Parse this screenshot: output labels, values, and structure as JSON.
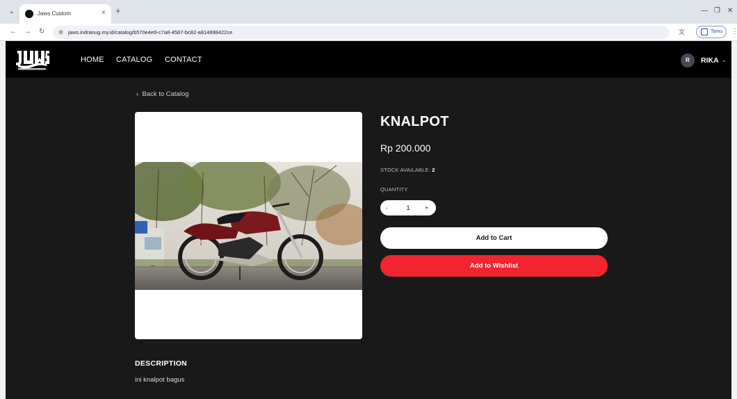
{
  "browser": {
    "tab_title": "Jaws Custom",
    "tab_close": "×",
    "new_tab": "+",
    "url": "jaws.indranug.my.id/catalog/b570e4e9-c7a8-4587-bc82-a814898422ce",
    "profile_label": "Tamu",
    "icons": [
      "tab-search-icon",
      "back-arrow-icon",
      "forward-arrow-icon",
      "reload-icon",
      "site-info-icon",
      "translate-icon",
      "profile-icon",
      "menu-kebab-icon",
      "minimize-icon",
      "restore-icon",
      "close-window-icon"
    ]
  },
  "header": {
    "logo_alt": "Jaws Custom Motorcycle",
    "nav": [
      {
        "label": "HOME"
      },
      {
        "label": "CATALOG"
      },
      {
        "label": "CONTACT"
      }
    ],
    "user_initial": "R",
    "user_name": "RIKA"
  },
  "product": {
    "back_label": "Back to Catalog",
    "title": "KNALPOT",
    "price": "Rp 200.000",
    "stock_label": "STOCK AVAILABLE:",
    "stock_value": "2",
    "quantity_label": "QUANTITY",
    "quantity_value": "1",
    "qty_minus": "-",
    "qty_plus": "+",
    "add_to_cart_label": "Add to Cart",
    "add_to_wishlist_label": "Add to Wishlist",
    "description_heading": "DESCRIPTION",
    "description_text": "ini knalpot bagus"
  },
  "colors": {
    "page_bg": "#191919",
    "header_bg": "#000000",
    "wishlist_red": "#f1242f",
    "cart_white": "#ffffff"
  }
}
